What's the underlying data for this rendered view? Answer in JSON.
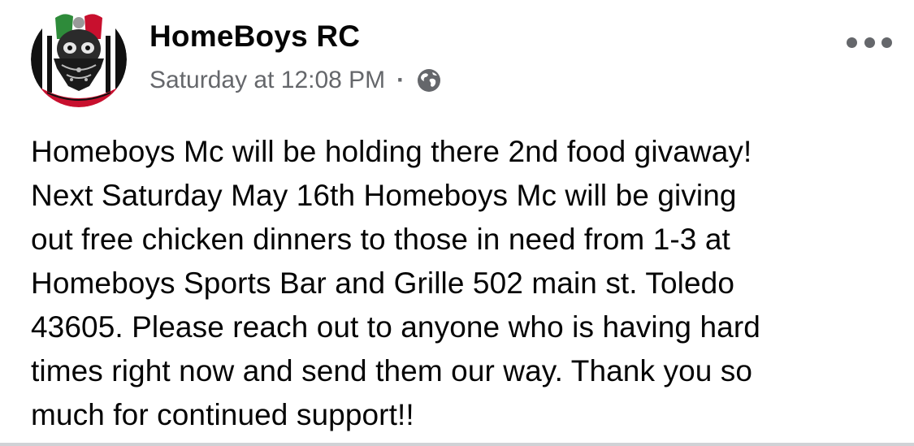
{
  "post": {
    "author": "HomeBoys RC",
    "timestamp": "Saturday at 12:08 PM",
    "separator": "·",
    "privacy_icon": "globe-icon",
    "more_icon": "more-options-icon",
    "text": "Homeboys Mc will be holding there 2nd food givaway!\nNext Saturday May 16th Homeboys Mc will be giving\nout free chicken dinners to those in need from 1-3 at\nHomeboys Sports Bar and Grille 502 main st. Toledo\n43605. Please reach out to anyone who is having hard\ntimes right now and send them our way. Thank you so\nmuch for continued support!!"
  },
  "colors": {
    "primary_text": "#050505",
    "secondary_text": "#65676b",
    "divider": "#d0d2d6",
    "background": "#ffffff"
  }
}
